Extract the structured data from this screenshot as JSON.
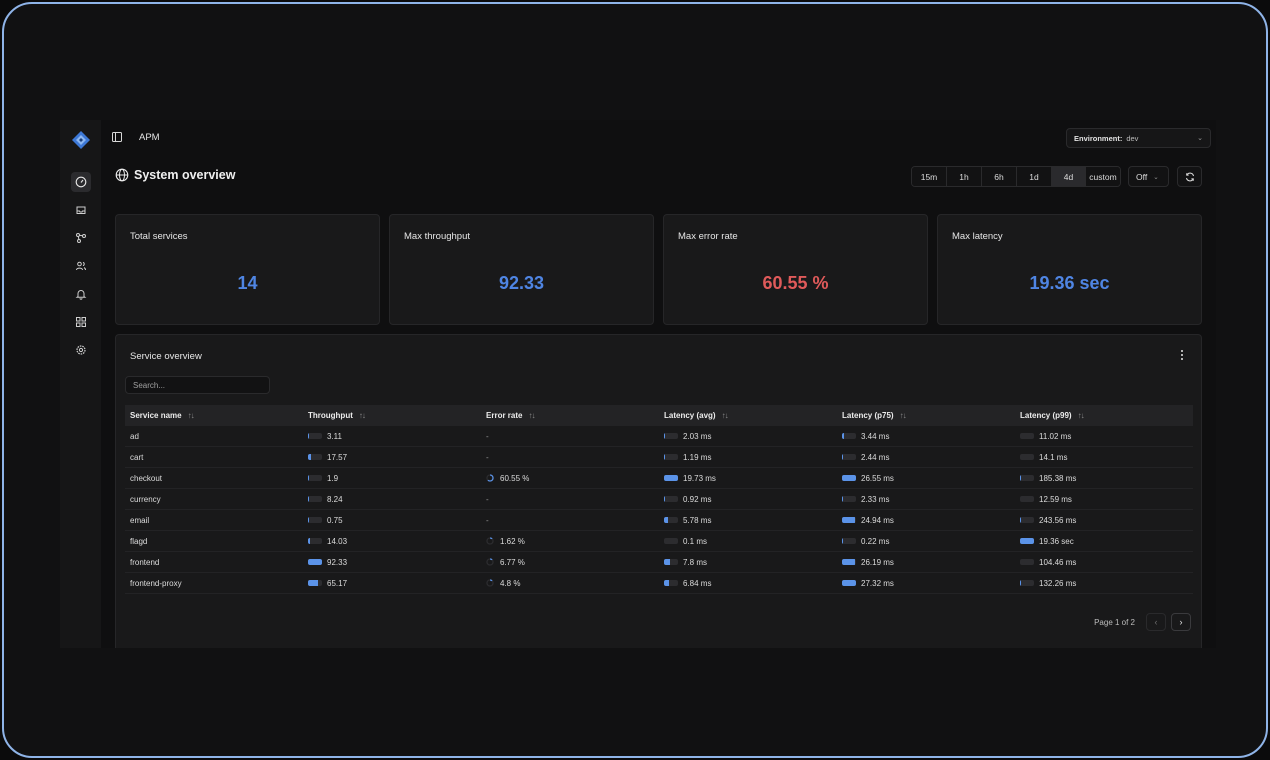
{
  "breadcrumb": "APM",
  "environment": {
    "label": "Environment:",
    "value": "dev"
  },
  "page_title": "System overview",
  "time_ranges": [
    {
      "label": "15m",
      "active": false
    },
    {
      "label": "1h",
      "active": false
    },
    {
      "label": "6h",
      "active": false
    },
    {
      "label": "1d",
      "active": false
    },
    {
      "label": "4d",
      "active": true
    },
    {
      "label": "custom",
      "active": false
    }
  ],
  "auto_refresh": "Off",
  "stats": [
    {
      "label": "Total services",
      "value": "14",
      "color": "#4f85e3"
    },
    {
      "label": "Max throughput",
      "value": "92.33",
      "color": "#4f85e3"
    },
    {
      "label": "Max error rate",
      "value": "60.55 %",
      "color": "#e05a5a"
    },
    {
      "label": "Max latency",
      "value": "19.36 sec",
      "color": "#4f85e3"
    }
  ],
  "service_overview": {
    "title": "Service overview",
    "search_placeholder": "Search...",
    "columns": [
      "Service name",
      "Throughput",
      "Error rate",
      "Latency (avg)",
      "Latency (p75)",
      "Latency (p99)"
    ],
    "rows": [
      {
        "name": "ad",
        "throughput": "3.11",
        "error_rate": "-",
        "latency_avg": "2.03 ms",
        "latency_p75": "3.44 ms",
        "latency_p99": "11.02 ms"
      },
      {
        "name": "cart",
        "throughput": "17.57",
        "error_rate": "-",
        "latency_avg": "1.19 ms",
        "latency_p75": "2.44 ms",
        "latency_p99": "14.1 ms"
      },
      {
        "name": "checkout",
        "throughput": "1.9",
        "error_rate": "60.55 %",
        "latency_avg": "19.73 ms",
        "latency_p75": "26.55 ms",
        "latency_p99": "185.38 ms"
      },
      {
        "name": "currency",
        "throughput": "8.24",
        "error_rate": "-",
        "latency_avg": "0.92 ms",
        "latency_p75": "2.33 ms",
        "latency_p99": "12.59 ms"
      },
      {
        "name": "email",
        "throughput": "0.75",
        "error_rate": "-",
        "latency_avg": "5.78 ms",
        "latency_p75": "24.94 ms",
        "latency_p99": "243.56 ms"
      },
      {
        "name": "flagd",
        "throughput": "14.03",
        "error_rate": "1.62 %",
        "latency_avg": "0.1 ms",
        "latency_p75": "0.22 ms",
        "latency_p99": "19.36 sec"
      },
      {
        "name": "frontend",
        "throughput": "92.33",
        "error_rate": "6.77 %",
        "latency_avg": "7.8 ms",
        "latency_p75": "26.19 ms",
        "latency_p99": "104.46 ms"
      },
      {
        "name": "frontend-proxy",
        "throughput": "65.17",
        "error_rate": "4.8 %",
        "latency_avg": "6.84 ms",
        "latency_p75": "27.32 ms",
        "latency_p99": "132.26 ms"
      }
    ],
    "pagination": "Page 1 of 2"
  },
  "icons": {
    "logo": "diamond-logo-icon",
    "nav": [
      "dashboard-gauge-icon",
      "inbox-icon",
      "services-graph-icon",
      "users-icon",
      "bell-icon",
      "apps-grid-icon",
      "settings-gear-icon"
    ],
    "panel_toggle": "sidebar-panel-icon",
    "title": "globe-icon",
    "refresh": "refresh-icon",
    "menu": "more-vertical-icon"
  },
  "colors": {
    "accent": "#5b93e8",
    "error": "#e05a5a",
    "background": "#0f0f10",
    "card": "#19191a"
  }
}
